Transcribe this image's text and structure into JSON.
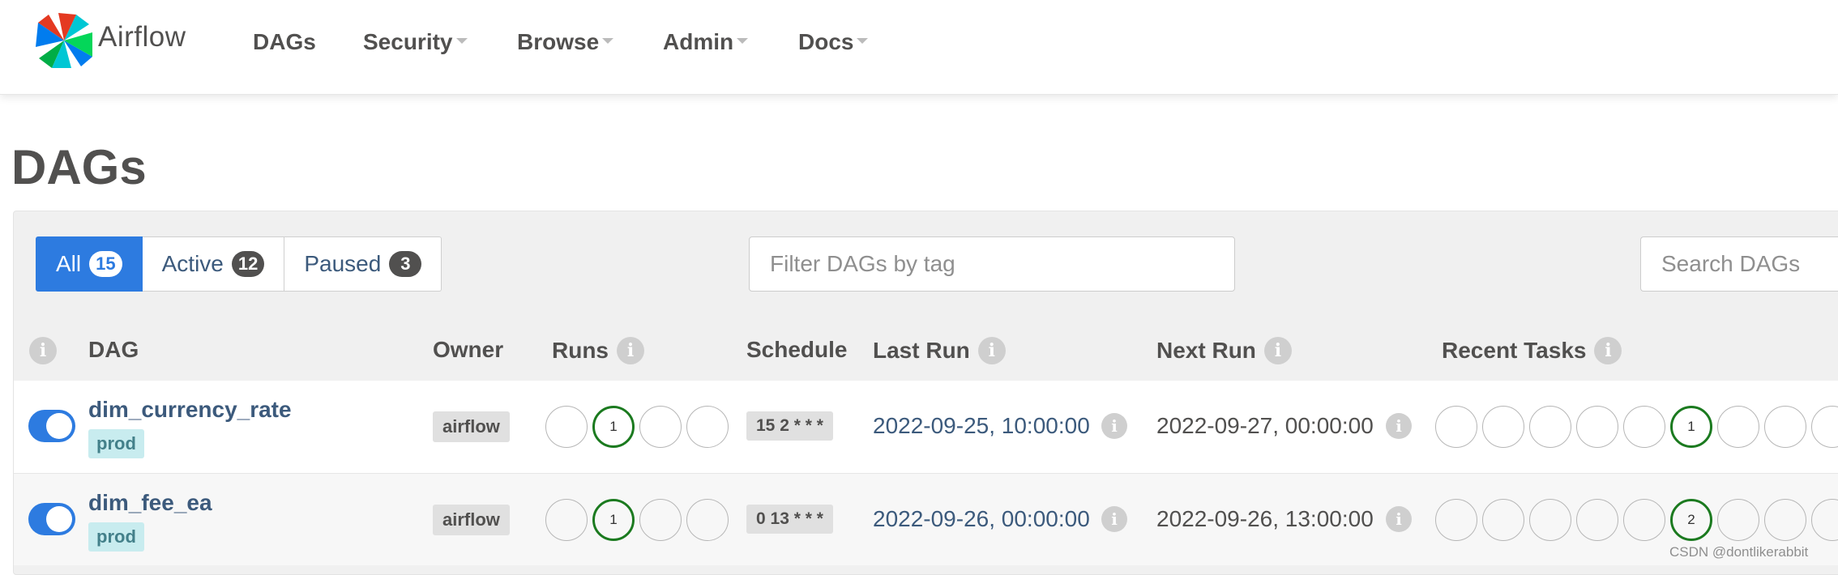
{
  "navbar": {
    "brand": "Airflow",
    "items": [
      {
        "label": "DAGs",
        "dropdown": false
      },
      {
        "label": "Security",
        "dropdown": true
      },
      {
        "label": "Browse",
        "dropdown": true
      },
      {
        "label": "Admin",
        "dropdown": true
      },
      {
        "label": "Docs",
        "dropdown": true
      }
    ]
  },
  "page_title": "DAGs",
  "filters": {
    "tabs": [
      {
        "label": "All",
        "count": "15",
        "active": true
      },
      {
        "label": "Active",
        "count": "12",
        "active": false
      },
      {
        "label": "Paused",
        "count": "3",
        "active": false
      }
    ],
    "tag_placeholder": "Filter DAGs by tag",
    "search_placeholder": "Search DAGs"
  },
  "table": {
    "headers": {
      "dag": "DAG",
      "owner": "Owner",
      "runs": "Runs",
      "schedule": "Schedule",
      "last_run": "Last Run",
      "next_run": "Next Run",
      "recent_tasks": "Recent Tasks"
    },
    "info_glyph": "i",
    "rows": [
      {
        "dag_id": "dim_currency_rate",
        "tag": "prod",
        "owner": "airflow",
        "runs": [
          "",
          "1",
          "",
          ""
        ],
        "schedule": "15 2 * * *",
        "last_run": "2022-09-25, 10:00:00",
        "next_run": "2022-09-27, 00:00:00",
        "recent_tasks": [
          "",
          "",
          "",
          "",
          "",
          "1",
          "",
          "",
          ""
        ]
      },
      {
        "dag_id": "dim_fee_ea",
        "tag": "prod",
        "owner": "airflow",
        "runs": [
          "",
          "1",
          "",
          ""
        ],
        "schedule": "0 13 * * *",
        "last_run": "2022-09-26, 00:00:00",
        "next_run": "2022-09-26, 13:00:00",
        "recent_tasks": [
          "",
          "",
          "",
          "",
          "",
          "2",
          "",
          "",
          ""
        ]
      }
    ]
  },
  "colors": {
    "primary": "#2d7be0",
    "success": "#1b7a1f",
    "link": "#3c5a7c",
    "text": "#51504f"
  },
  "watermark": "CSDN @dontlikerabbit"
}
